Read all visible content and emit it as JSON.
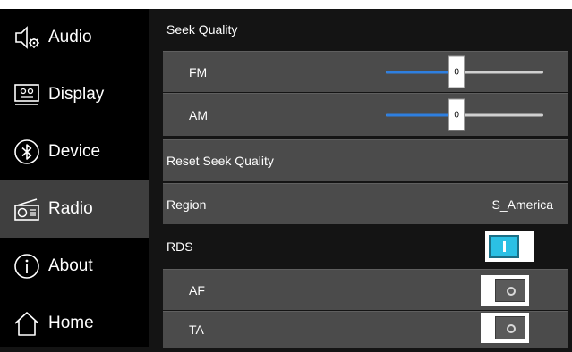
{
  "sidebar": {
    "items": [
      {
        "label": "Audio",
        "icon": "speaker-settings-icon",
        "active": false
      },
      {
        "label": "Display",
        "icon": "display-icon",
        "active": false
      },
      {
        "label": "Device",
        "icon": "bluetooth-icon",
        "active": false
      },
      {
        "label": "Radio",
        "icon": "radio-icon",
        "active": true
      },
      {
        "label": "About",
        "icon": "info-icon",
        "active": false
      },
      {
        "label": "Home",
        "icon": "home-icon",
        "active": false
      }
    ]
  },
  "seek_quality": {
    "title": "Seek Quality",
    "fm": {
      "label": "FM",
      "value": "0",
      "fill_fraction": 0.45
    },
    "am": {
      "label": "AM",
      "value": "0",
      "fill_fraction": 0.45
    },
    "reset_label": "Reset Seek Quality"
  },
  "region": {
    "label": "Region",
    "value": "S_America"
  },
  "rds": {
    "title": "RDS",
    "enabled": true,
    "af": {
      "label": "AF",
      "enabled": false
    },
    "ta": {
      "label": "TA",
      "enabled": false
    }
  },
  "colors": {
    "accent_blue": "#2e7fe0",
    "toggle_on": "#2bc0e4",
    "row_background": "#4b4b4b",
    "active_nav": "#3f3f3f"
  }
}
